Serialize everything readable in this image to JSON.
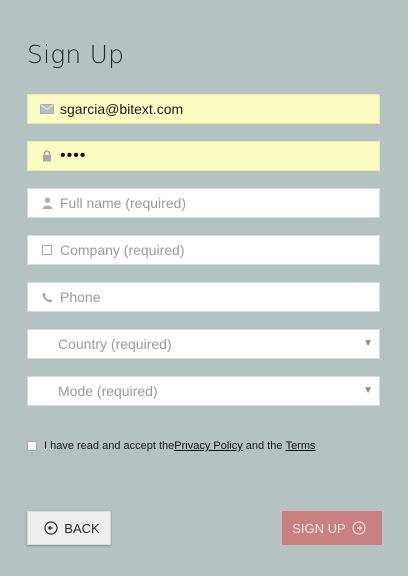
{
  "page": {
    "title": "Sign Up"
  },
  "form": {
    "email": {
      "value": "sgarcia@bitext.com",
      "icon": "envelope-icon"
    },
    "password": {
      "masked_value": "••••",
      "icon": "lock-icon"
    },
    "full_name": {
      "placeholder": "Full name (required)",
      "icon": "user-icon"
    },
    "company": {
      "placeholder": "Company (required)",
      "icon": "building-icon"
    },
    "phone": {
      "placeholder": "Phone",
      "icon": "phone-icon"
    },
    "country": {
      "selected": "Country (required)"
    },
    "mode": {
      "selected": "Mode (required)"
    }
  },
  "consent": {
    "prefix": "I have read and accept the ",
    "privacy_link": "Privacy Policy",
    "middle": " and the ",
    "terms_link": "Terms",
    "checked": false
  },
  "actions": {
    "back_label": "BACK",
    "signup_label": "SIGN UP"
  },
  "colors": {
    "background": "#b5c2c2",
    "autofill": "#fbfcc2",
    "signup_button": "#c98081",
    "back_button": "#eeeeee"
  }
}
